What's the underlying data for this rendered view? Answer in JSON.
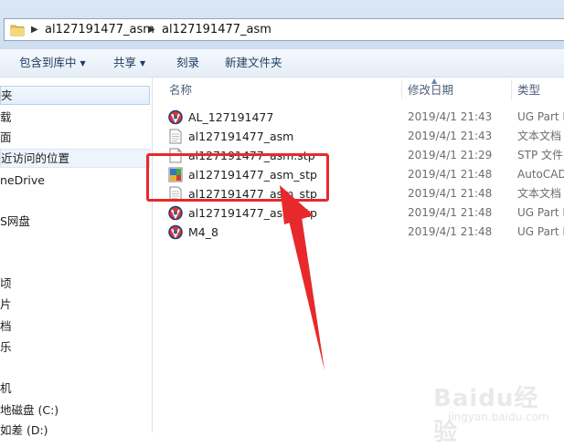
{
  "address_bar": {
    "crumbs": [
      "al127191477_asm",
      "al127191477_asm"
    ]
  },
  "toolbar": {
    "include_library": "包含到库中",
    "share": "共享",
    "burn": "刻录",
    "new_folder": "新建文件夹"
  },
  "nav": {
    "items": [
      "夹",
      "载",
      "面",
      "近访问的位置",
      "neDrive",
      "S网盘",
      "顷",
      "片",
      "档",
      "乐",
      "机",
      "地磁盘 (C:)",
      "如差 (D:)"
    ]
  },
  "file_list": {
    "columns": {
      "name": "名称",
      "date": "修改日期",
      "type": "类型"
    },
    "rows": [
      {
        "name": "AL_127191477",
        "date": "2019/4/1 21:43",
        "type": "UG Part I",
        "icon": "ug-part-icon"
      },
      {
        "name": "al127191477_asm",
        "date": "2019/4/1 21:43",
        "type": "文本文档",
        "icon": "text-document-icon"
      },
      {
        "name": "al127191477_asm.stp",
        "date": "2019/4/1 21:29",
        "type": "STP 文件",
        "icon": "blank-file-icon"
      },
      {
        "name": "al127191477_asm_stp",
        "date": "2019/4/1 21:48",
        "type": "AutoCAD",
        "icon": "autocad-file-icon"
      },
      {
        "name": "al127191477_asm_stp",
        "date": "2019/4/1 21:48",
        "type": "文本文档",
        "icon": "text-document-icon"
      },
      {
        "name": "al127191477_asm_stp",
        "date": "2019/4/1 21:48",
        "type": "UG Part I",
        "icon": "ug-part-icon"
      },
      {
        "name": "M4_8",
        "date": "2019/4/1 21:48",
        "type": "UG Part I",
        "icon": "ug-part-icon"
      }
    ]
  },
  "watermark": {
    "text": "Baidu经验",
    "sub": "jingyan.baidu.com"
  },
  "colors": {
    "annotation_red": "#e8292b",
    "toolbar_text": "#1e3a5f",
    "selection_border": "#b8d0ea"
  }
}
